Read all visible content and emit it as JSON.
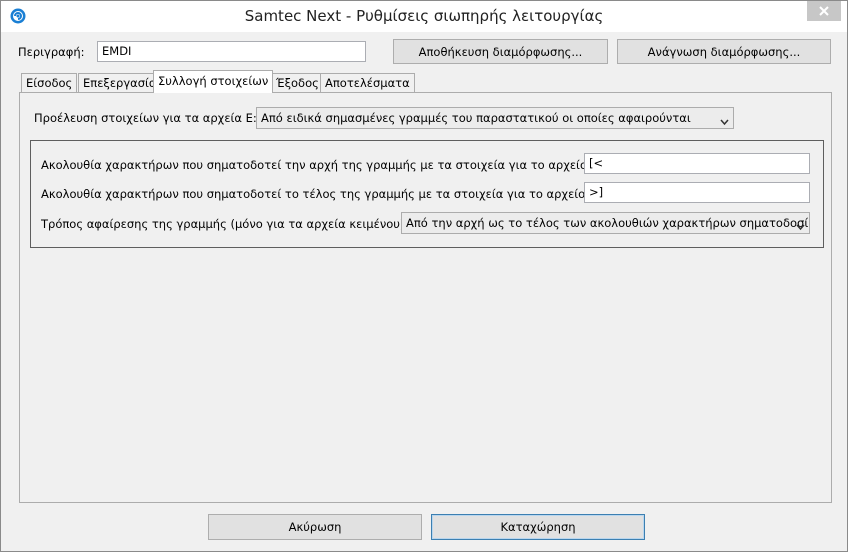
{
  "window": {
    "title": "Samtec Next - Ρυθμίσεις σιωπηρής λειτουργίας",
    "icon": "samtec-app-icon",
    "close_icon": "close-icon"
  },
  "description": {
    "label": "Περιγραφή:",
    "value": "EMDI"
  },
  "config_buttons": {
    "save": "Αποθήκευση διαμόρφωσης...",
    "load": "Ανάγνωση διαμόρφωσης..."
  },
  "tabs": [
    {
      "label": "Είσοδος"
    },
    {
      "label": "Επεξεργασία"
    },
    {
      "label": "Συλλογή στοιχείων",
      "active": true
    },
    {
      "label": "Έξοδος"
    },
    {
      "label": "Αποτελέσματα"
    }
  ],
  "data_source": {
    "label": "Προέλευση στοιχείων για τα αρχεία Ε:",
    "selected": "Από ειδικά σημασμένες γραμμές του παραστατικού οι οποίες αφαιρούνται"
  },
  "markers": {
    "start_label": "Ακολουθία χαρακτήρων που σηματοδοτεί την αρχή της γραμμής με τα στοιχεία για το αρχείο Ε:",
    "start_value": "[<",
    "end_label": "Ακολουθία χαρακτήρων που σηματοδοτεί το τέλος της γραμμής με τα στοιχεία για το αρχείο Ε:",
    "end_value": ">]",
    "removal_label": "Τρόπος αφαίρεσης της γραμμής (μόνο για τα αρχεία κειμένου):",
    "removal_selected": "Από την αρχή ως το τέλος των ακολουθιών χαρακτήρων σηματοδοσί"
  },
  "footer": {
    "cancel": "Ακύρωση",
    "submit": "Καταχώρηση"
  }
}
